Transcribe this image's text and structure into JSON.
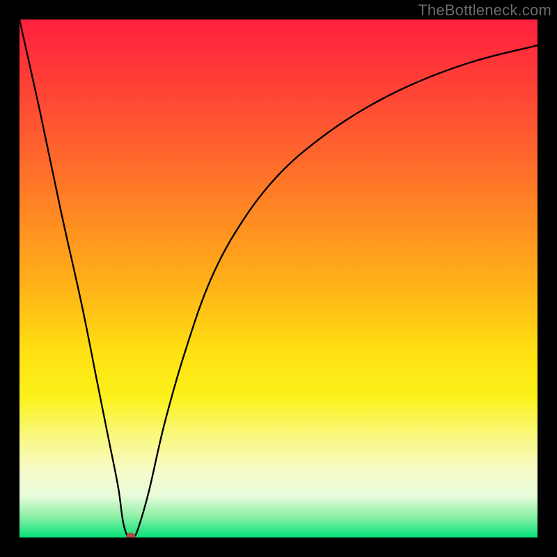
{
  "watermark": "TheBottleneck.com",
  "chart_data": {
    "type": "line",
    "title": "",
    "xlabel": "",
    "ylabel": "",
    "xlim": [
      0,
      100
    ],
    "ylim": [
      0,
      100
    ],
    "grid": false,
    "legend": null,
    "background_gradient": {
      "direction": "vertical",
      "stops": [
        {
          "pos": 0,
          "color": "#ff1f3e"
        },
        {
          "pos": 22,
          "color": "#ff5a30"
        },
        {
          "pos": 52,
          "color": "#ffb418"
        },
        {
          "pos": 73,
          "color": "#fbf21b"
        },
        {
          "pos": 87,
          "color": "#f7fbc9"
        },
        {
          "pos": 100,
          "color": "#05e27b"
        }
      ]
    },
    "series": [
      {
        "name": "bottleneck-curve",
        "x": [
          0,
          4,
          8,
          12,
          15,
          17,
          19,
          20,
          21,
          22,
          23,
          25,
          28,
          32,
          37,
          43,
          50,
          58,
          67,
          77,
          88,
          100
        ],
        "y": [
          100,
          82,
          63,
          45,
          30,
          20,
          10,
          3,
          0,
          0,
          2,
          9,
          22,
          36,
          50,
          61,
          70,
          77,
          83,
          88,
          92,
          95
        ]
      }
    ],
    "annotations": [
      {
        "type": "point",
        "name": "optimal-marker",
        "x": 21.5,
        "y": 0,
        "color": "#b34a43"
      }
    ]
  }
}
